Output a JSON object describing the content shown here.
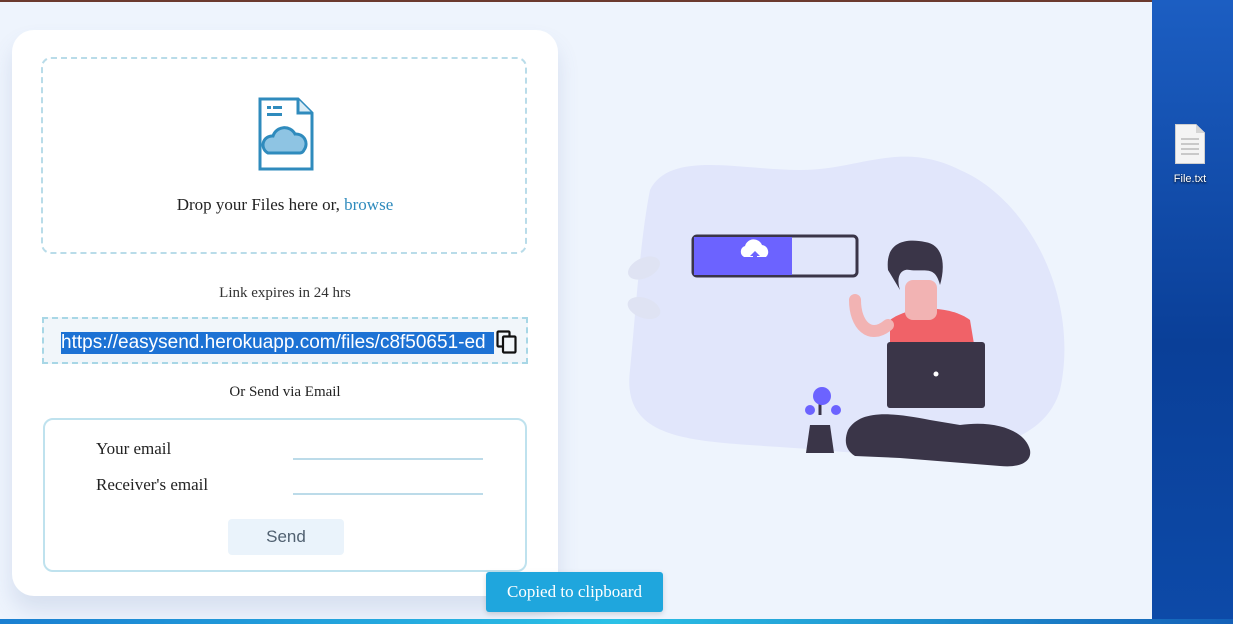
{
  "upload": {
    "drop_text": "Drop your Files here or,",
    "browse_label": "browse",
    "file_icon": "cloud-file-icon"
  },
  "share": {
    "expires_text": "Link expires in 24 hrs",
    "link_url": "https://easysend.herokuapp.com/files/c8f50651-ed",
    "copy_icon": "copy-icon"
  },
  "email": {
    "heading": "Or Send via Email",
    "your_email_label": "Your email",
    "your_email_value": "",
    "receiver_email_label": "Receiver's email",
    "receiver_email_value": "",
    "send_label": "Send"
  },
  "toast": {
    "text": "Copied to clipboard"
  },
  "desktop": {
    "file_name": "File.txt"
  },
  "colors": {
    "accent": "#1fa6dd",
    "link": "#2f8bbd",
    "selection": "#1d72d4",
    "illustration_bar": "#6c63ff",
    "shirt": "#f06268"
  }
}
